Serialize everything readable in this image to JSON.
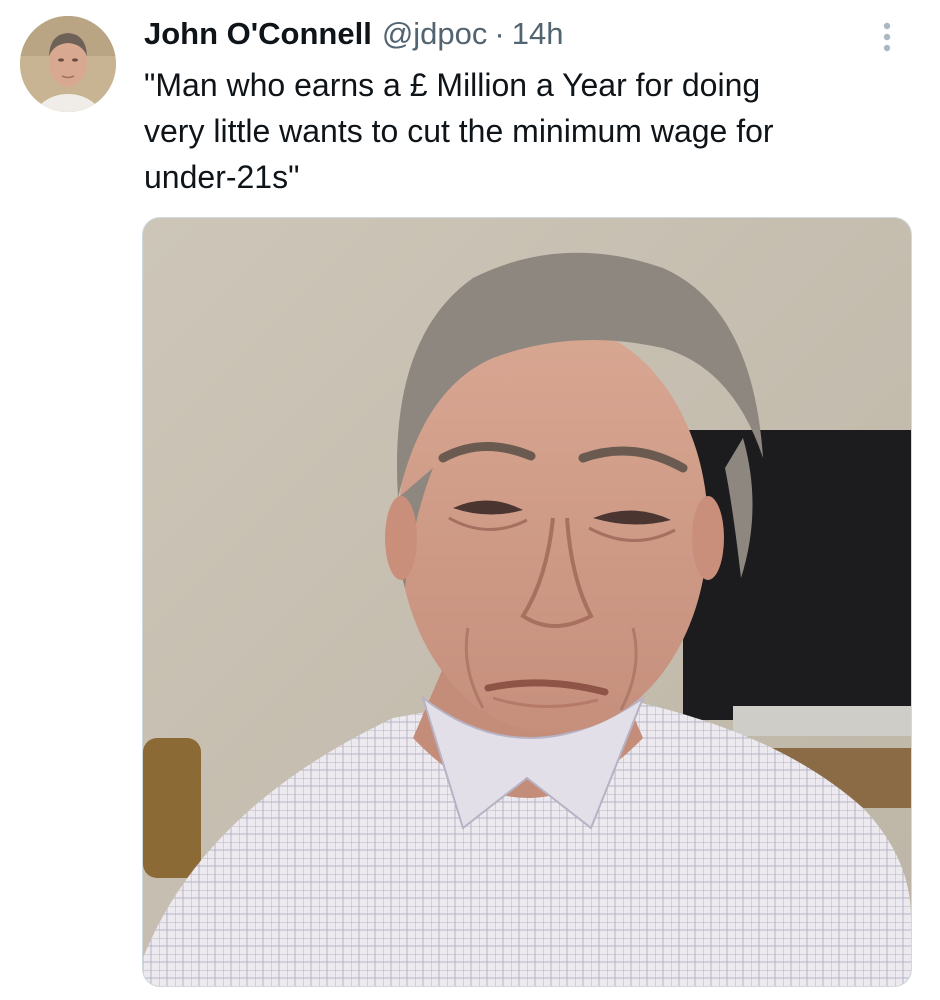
{
  "tweet": {
    "author": {
      "display_name": "John O'Connell",
      "handle": "@jdpoc",
      "avatar_icon": "profile-photo"
    },
    "separator": "·",
    "timestamp": "14h",
    "text": "\"Man who earns a £ Million a Year for doing\nvery little wants to cut the minimum wage for\nunder-21s\"",
    "more_icon": "more-vertical-icon",
    "media": {
      "type": "photo",
      "alt": "Photo of a grey-haired man in a checked shirt"
    }
  },
  "colors": {
    "text_primary": "#0f1419",
    "text_secondary": "#536471",
    "border": "#cfd9de",
    "more_icon": "#aab8c2"
  }
}
